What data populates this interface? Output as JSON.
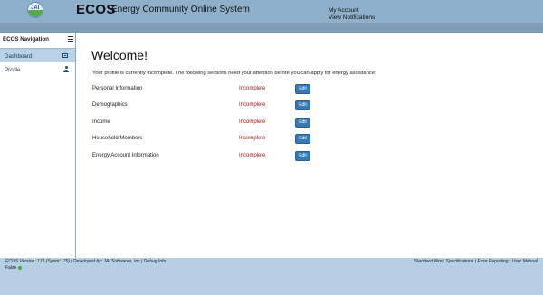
{
  "header": {
    "logo_text": "JAI",
    "app_name": "ECOS",
    "app_subtitle": "Energy Community Online System",
    "links": [
      "My Account",
      "View Notifications"
    ]
  },
  "sidebar": {
    "title": "ECOS Navigation",
    "items": [
      {
        "label": "Dashboard",
        "icon": "dashboard-icon",
        "active": true
      },
      {
        "label": "Profile",
        "icon": "user-icon",
        "active": false
      }
    ]
  },
  "main": {
    "heading": "Welcome!",
    "notice": "Your profile is currently incomplete. The following sections need your attention before you can apply for energy assistance:",
    "edit_label": "Edit",
    "sections": [
      {
        "name": "Personal Information",
        "status": "Incomplete"
      },
      {
        "name": "Demographics",
        "status": "Incomplete"
      },
      {
        "name": "Income",
        "status": "Incomplete"
      },
      {
        "name": "Household Members",
        "status": "Incomplete"
      },
      {
        "name": "Energy Account Information",
        "status": "Incomplete"
      }
    ]
  },
  "footer": {
    "version_text": "ECOS Version: 175 (Sprint:175) | Developed by: JAI Softwares, Inc | Debug Info",
    "status_text": "False",
    "links": [
      "Standard Work Specifications",
      "Error Reporting",
      "User Manual"
    ],
    "link_separator": " | "
  },
  "colors": {
    "header": "#8fb0cb",
    "footer": "#b6cfe5",
    "incomplete": "#9b1414",
    "button": "#3579b5"
  }
}
